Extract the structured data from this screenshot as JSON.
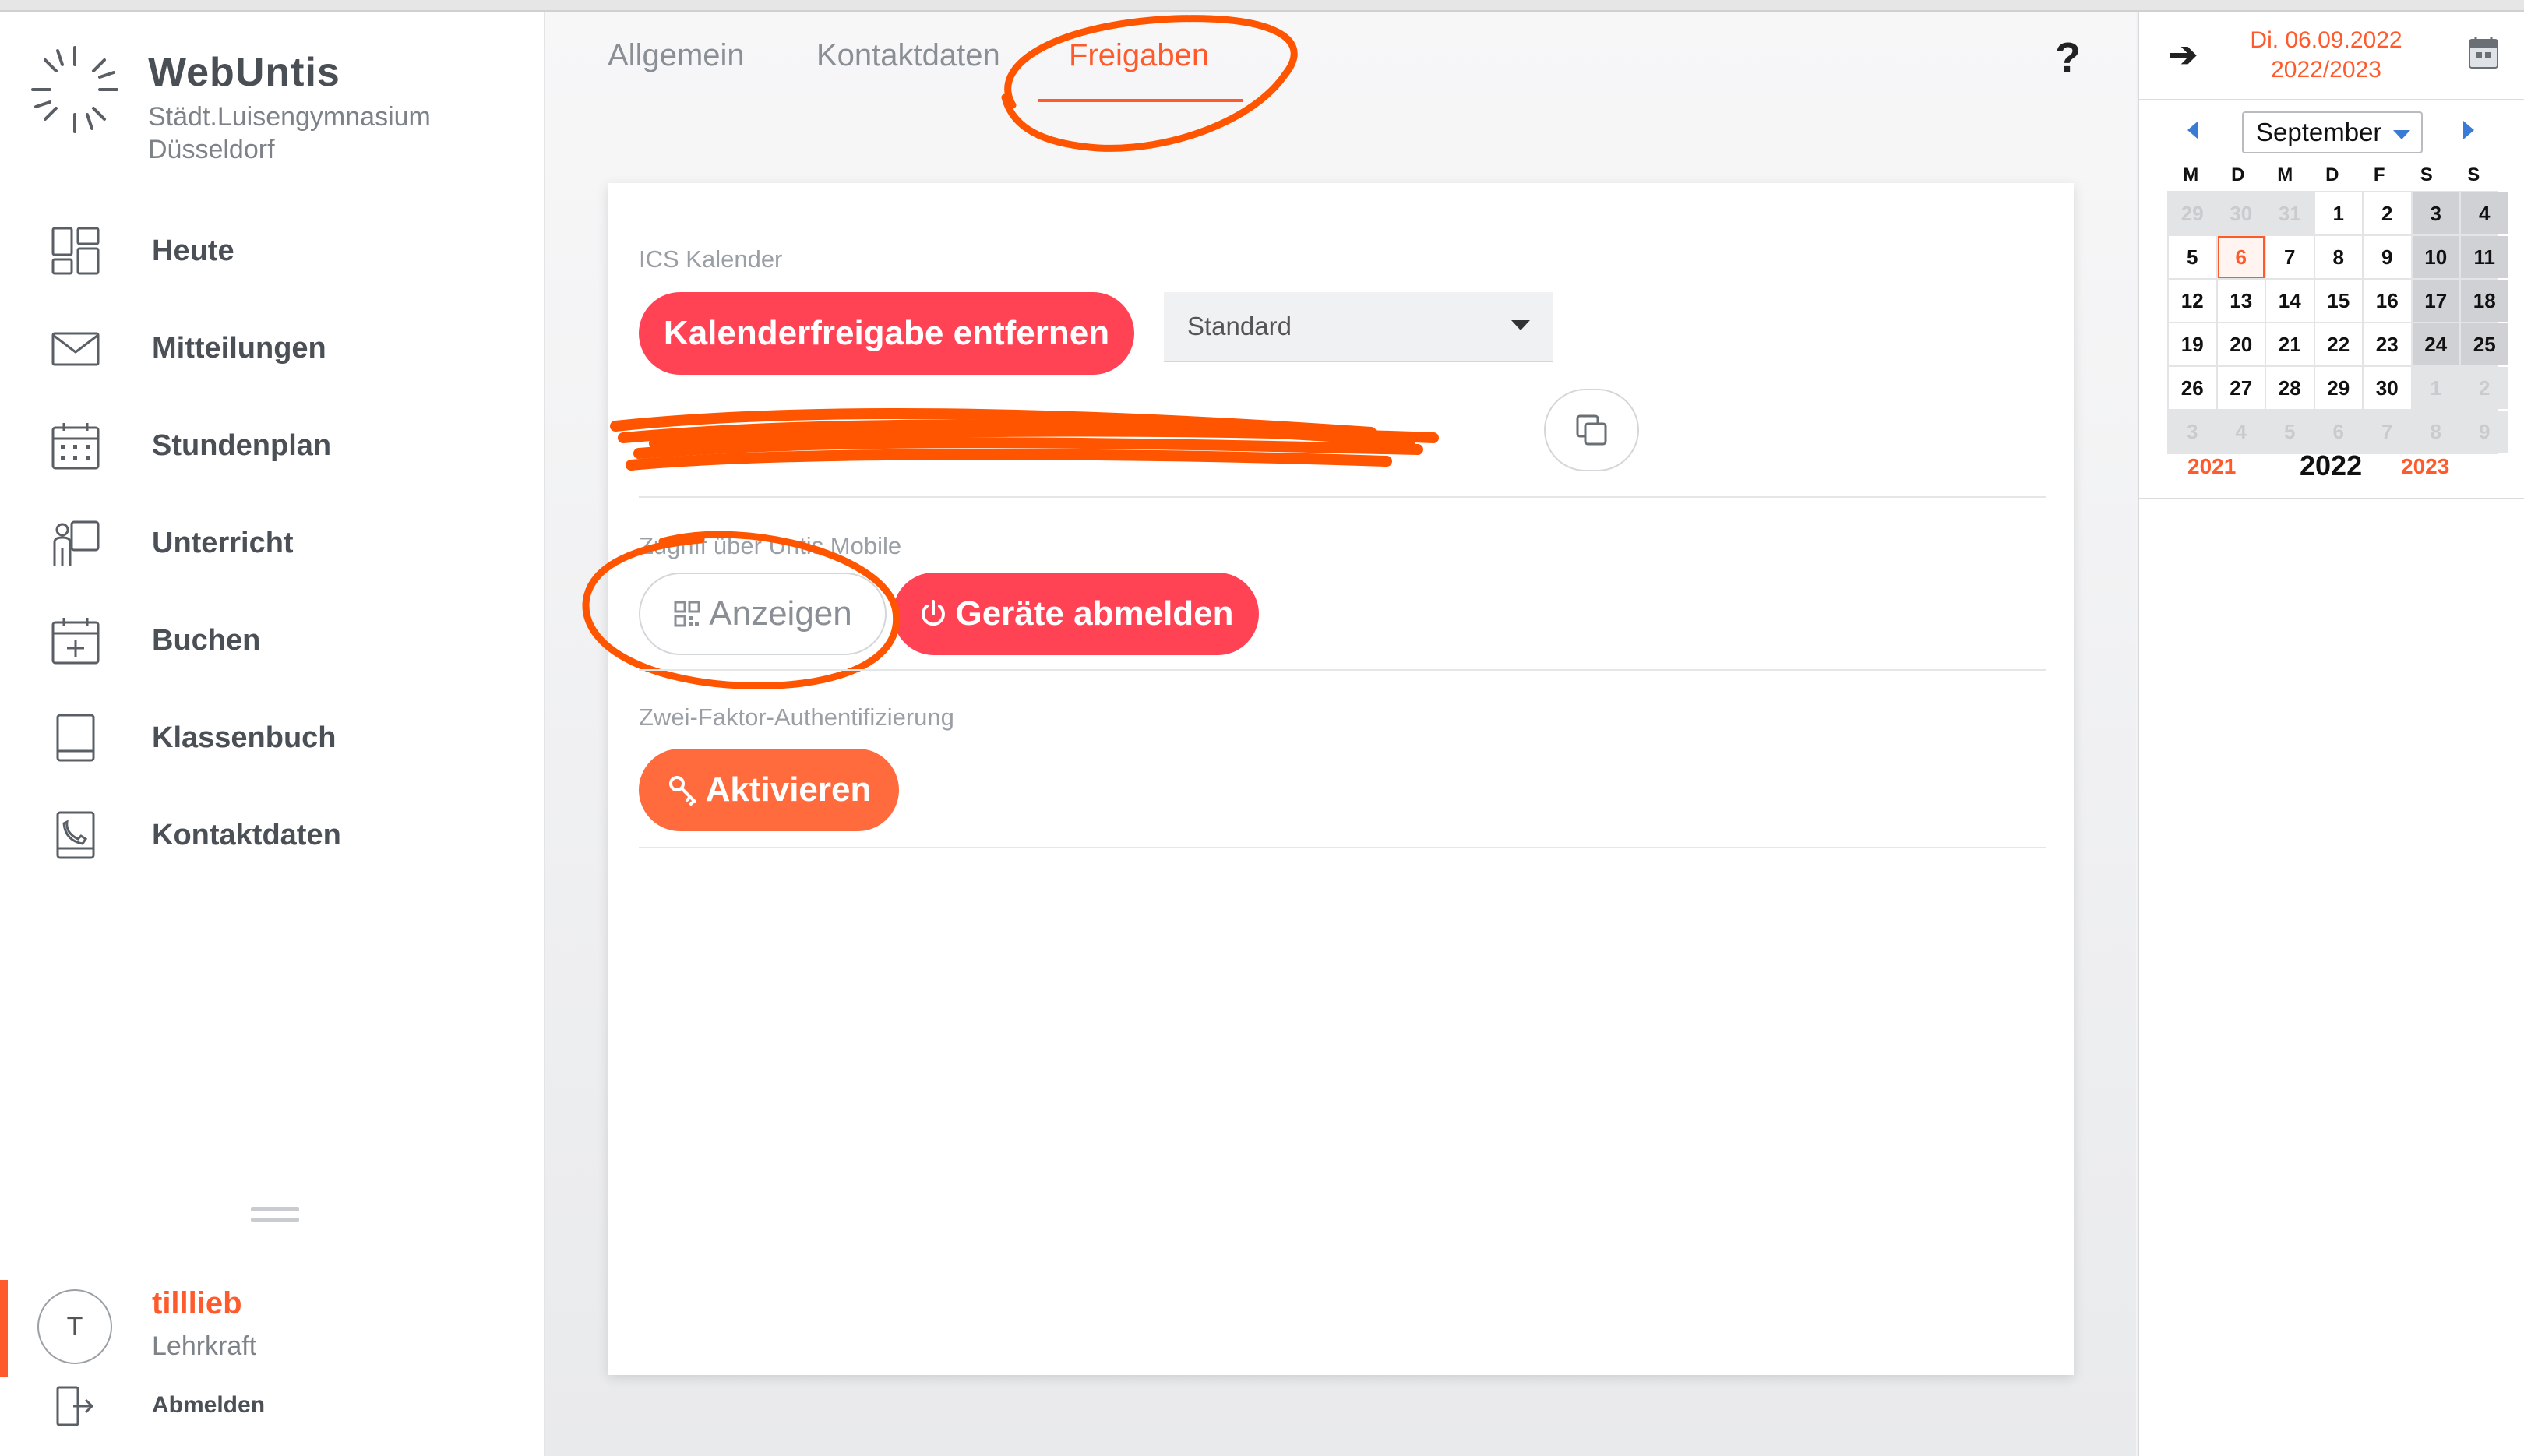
{
  "app": {
    "brand": "WebUntis",
    "school_line1": "Städt.Luisengymnasium",
    "school_line2": "Düsseldorf"
  },
  "sidebar": {
    "items": [
      {
        "label": "Heute",
        "icon": "dashboard-icon"
      },
      {
        "label": "Mitteilungen",
        "icon": "envelope-icon"
      },
      {
        "label": "Stundenplan",
        "icon": "calendar-grid-icon"
      },
      {
        "label": "Unterricht",
        "icon": "teacher-board-icon"
      },
      {
        "label": "Buchen",
        "icon": "calendar-plus-icon"
      },
      {
        "label": "Klassenbuch",
        "icon": "book-icon"
      },
      {
        "label": "Kontaktdaten",
        "icon": "contact-book-icon"
      }
    ],
    "user": {
      "initial": "T",
      "name": "tilllieb",
      "role": "Lehrkraft",
      "logout_label": "Abmelden"
    }
  },
  "tabs": [
    {
      "label": "Allgemein",
      "active": false
    },
    {
      "label": "Kontaktdaten",
      "active": false
    },
    {
      "label": "Freigaben",
      "active": true
    }
  ],
  "help_label": "?",
  "ics": {
    "section_label": "ICS Kalender",
    "remove_button": "Kalenderfreigabe entfernen",
    "select_value": "Standard"
  },
  "mobile": {
    "section_label": "Zugriff über Untis Mobile",
    "show_button": "Anzeigen",
    "logout_devices_button": "Geräte abmelden"
  },
  "twofa": {
    "section_label": "Zwei-Faktor-Authentifizierung",
    "activate_button": "Aktivieren"
  },
  "right_panel": {
    "date_line1": "Di. 06.09.2022",
    "date_line2": "2022/2023",
    "month": "September",
    "weekday_headers": [
      "M",
      "D",
      "M",
      "D",
      "F",
      "S",
      "S"
    ],
    "days": [
      {
        "d": "29",
        "m": true
      },
      {
        "d": "30",
        "m": true
      },
      {
        "d": "31",
        "m": true
      },
      {
        "d": "1"
      },
      {
        "d": "2"
      },
      {
        "d": "3",
        "w": true
      },
      {
        "d": "4",
        "w": true
      },
      {
        "d": "5"
      },
      {
        "d": "6",
        "t": true
      },
      {
        "d": "7"
      },
      {
        "d": "8"
      },
      {
        "d": "9"
      },
      {
        "d": "10",
        "w": true
      },
      {
        "d": "11",
        "w": true
      },
      {
        "d": "12"
      },
      {
        "d": "13"
      },
      {
        "d": "14"
      },
      {
        "d": "15"
      },
      {
        "d": "16"
      },
      {
        "d": "17",
        "w": true
      },
      {
        "d": "18",
        "w": true
      },
      {
        "d": "19"
      },
      {
        "d": "20"
      },
      {
        "d": "21"
      },
      {
        "d": "22"
      },
      {
        "d": "23"
      },
      {
        "d": "24",
        "w": true
      },
      {
        "d": "25",
        "w": true
      },
      {
        "d": "26"
      },
      {
        "d": "27"
      },
      {
        "d": "28"
      },
      {
        "d": "29"
      },
      {
        "d": "30"
      },
      {
        "d": "1",
        "m": true,
        "w": true
      },
      {
        "d": "2",
        "m": true,
        "w": true
      },
      {
        "d": "3",
        "m": true
      },
      {
        "d": "4",
        "m": true
      },
      {
        "d": "5",
        "m": true
      },
      {
        "d": "6",
        "m": true
      },
      {
        "d": "7",
        "m": true
      },
      {
        "d": "8",
        "m": true,
        "w": true
      },
      {
        "d": "9",
        "m": true,
        "w": true
      }
    ],
    "year_prev": "2021",
    "year_current": "2022",
    "year_next": "2023"
  },
  "colors": {
    "accent": "#ff5a2b",
    "danger": "#ff4254",
    "annotation": "#ff5500"
  }
}
